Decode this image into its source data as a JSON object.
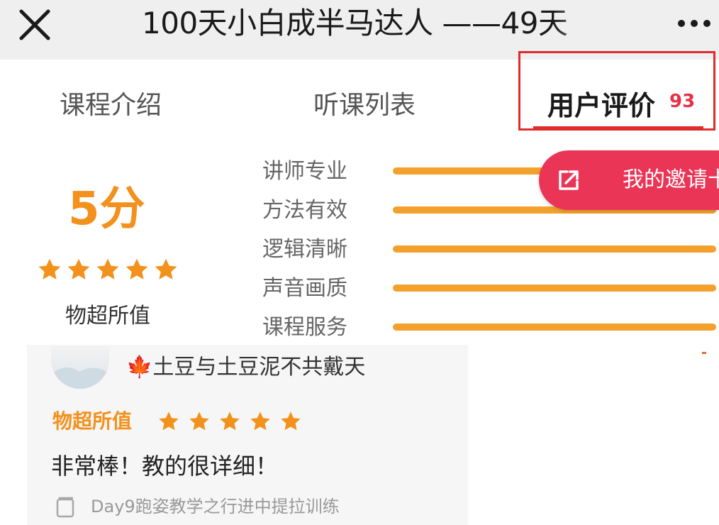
{
  "header": {
    "title": "100天小白成半马达人 ——49天",
    "close_icon": "close-icon",
    "more_icon": "more-dots-icon"
  },
  "tabs": [
    {
      "label": "课程介绍",
      "active": false
    },
    {
      "label": "听课列表",
      "active": false
    },
    {
      "label": "用户评价",
      "active": true,
      "count": "93"
    }
  ],
  "rating": {
    "score": "5分",
    "stars": 5,
    "summary": "物超所值",
    "dimensions": [
      {
        "label": "讲师专业",
        "value": 1.0
      },
      {
        "label": "方法有效",
        "value": 1.0
      },
      {
        "label": "逻辑清晰",
        "value": 1.0
      },
      {
        "label": "声音画质",
        "value": 1.0
      },
      {
        "label": "课程服务",
        "value": 1.0
      }
    ]
  },
  "invite": {
    "label": "我的邀请卡",
    "icon": "share-icon"
  },
  "review": {
    "user": "🍁土豆与土豆泥不共戴天",
    "tag": "物超所值",
    "stars": 5,
    "text": "非常棒！教的很详细！",
    "lesson": "Day9跑姿教学之行进中提拉训练",
    "lesson_icon": "document-icon"
  },
  "colors": {
    "accent_orange": "#f2911c",
    "bar_orange": "#f3a12c",
    "invite_red": "#ea3556",
    "highlight_red": "#e02b2b",
    "count_red": "#e6304a"
  }
}
